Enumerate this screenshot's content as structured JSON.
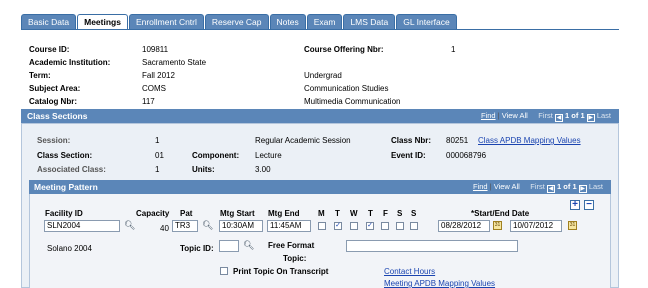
{
  "tabs": [
    "Basic Data",
    "Meetings",
    "Enrollment Cntrl",
    "Reserve Cap",
    "Notes",
    "Exam",
    "LMS Data",
    "GL Interface"
  ],
  "header": {
    "course_id_label": "Course ID:",
    "course_id": "109811",
    "course_offering_label": "Course Offering Nbr:",
    "course_offering": "1",
    "institution_label": "Academic Institution:",
    "institution": "Sacramento State",
    "term_label": "Term:",
    "term": "Fall 2012",
    "career": "Undergrad",
    "subject_label": "Subject Area:",
    "subject": "COMS",
    "subject_desc": "Communication Studies",
    "catalog_label": "Catalog Nbr:",
    "catalog": "117",
    "catalog_desc": "Multimedia Communication"
  },
  "class_sections": {
    "title": "Class Sections",
    "nav": {
      "find": "Find",
      "view_all": "View All",
      "first": "First",
      "count": "1 of 1",
      "last": "Last"
    },
    "session_label": "Session:",
    "session": "1",
    "session_desc": "Regular Academic Session",
    "class_nbr_label": "Class Nbr:",
    "class_nbr": "80251",
    "apdb_link": "Class APDB Mapping Values",
    "class_section_label": "Class Section:",
    "class_section": "01",
    "component_label": "Component:",
    "component": "Lecture",
    "event_label": "Event ID:",
    "event": "000068796",
    "assoc_label": "Associated Class:",
    "assoc": "1",
    "units_label": "Units:",
    "units": "3.00"
  },
  "meeting_pattern": {
    "title": "Meeting Pattern",
    "nav": {
      "find": "Find",
      "view_all": "View All",
      "first": "First",
      "count": "1 of 1",
      "last": "Last"
    },
    "facility_label": "Facility ID",
    "facility": "SLN2004",
    "capacity_label": "Capacity",
    "capacity": "40",
    "pat_label": "Pat",
    "pat": "TR3",
    "mtg_start_label": "Mtg Start",
    "mtg_start": "10:30AM",
    "mtg_end_label": "Mtg End",
    "mtg_end": "11:45AM",
    "days": [
      "M",
      "T",
      "W",
      "T",
      "F",
      "S",
      "S"
    ],
    "days_checked": [
      false,
      true,
      false,
      true,
      false,
      false,
      false
    ],
    "dates_label": "*Start/End Date",
    "start_date": "08/28/2012",
    "end_date": "10/07/2012",
    "facility_desc": "Solano  2004",
    "topic_label": "Topic ID:",
    "topic": "",
    "free_format_label": "Free Format",
    "free_format_label2": "Topic:",
    "free_format": "",
    "print_topic_label": "Print Topic On Transcript",
    "contact_hours_link": "Contact Hours",
    "meeting_apdb_link": "Meeting APDB Mapping Values"
  },
  "colors": {
    "accent": "#5b86b8",
    "link": "#1a44b0"
  }
}
